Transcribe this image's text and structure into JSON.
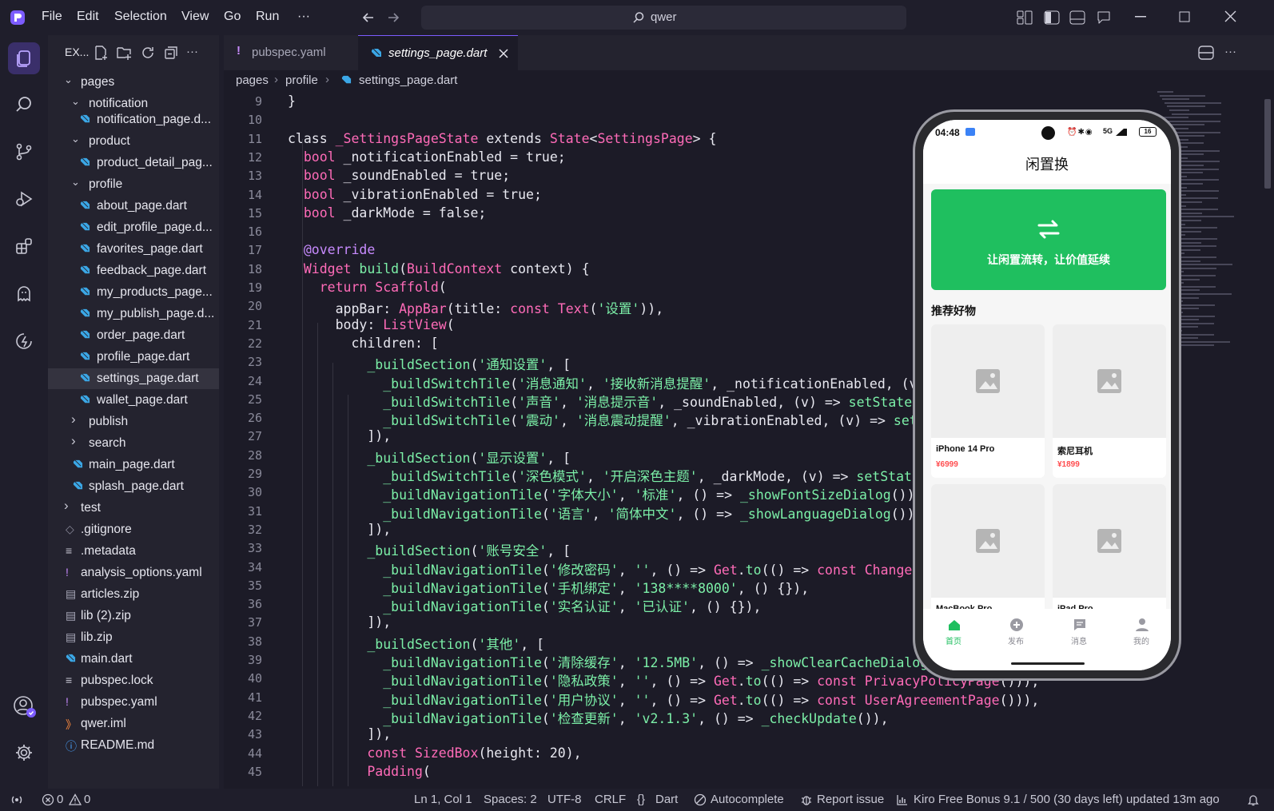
{
  "menu": [
    "File",
    "Edit",
    "Selection",
    "View",
    "Go",
    "Run",
    "···"
  ],
  "search": {
    "text": "qwer"
  },
  "explorer": {
    "title": "EX...",
    "items": [
      {
        "label": "pages",
        "kind": "folder-open",
        "indent": 1
      },
      {
        "label": "notification",
        "kind": "folder-open",
        "indent": 2
      },
      {
        "label": "notification_page.d...",
        "kind": "dart",
        "indent": 3
      },
      {
        "label": "product",
        "kind": "folder-open",
        "indent": 2
      },
      {
        "label": "product_detail_pag...",
        "kind": "dart",
        "indent": 3
      },
      {
        "label": "profile",
        "kind": "folder-open",
        "indent": 2
      },
      {
        "label": "about_page.dart",
        "kind": "dart",
        "indent": 3
      },
      {
        "label": "edit_profile_page.d...",
        "kind": "dart",
        "indent": 3
      },
      {
        "label": "favorites_page.dart",
        "kind": "dart",
        "indent": 3
      },
      {
        "label": "feedback_page.dart",
        "kind": "dart",
        "indent": 3
      },
      {
        "label": "my_products_page...",
        "kind": "dart",
        "indent": 3
      },
      {
        "label": "my_publish_page.d...",
        "kind": "dart",
        "indent": 3
      },
      {
        "label": "order_page.dart",
        "kind": "dart",
        "indent": 3
      },
      {
        "label": "profile_page.dart",
        "kind": "dart",
        "indent": 3
      },
      {
        "label": "settings_page.dart",
        "kind": "dart",
        "indent": 3,
        "selected": true
      },
      {
        "label": "wallet_page.dart",
        "kind": "dart",
        "indent": 3
      },
      {
        "label": "publish",
        "kind": "folder-closed",
        "indent": 2
      },
      {
        "label": "search",
        "kind": "folder-closed",
        "indent": 2
      },
      {
        "label": "main_page.dart",
        "kind": "dart",
        "indent": 2
      },
      {
        "label": "splash_page.dart",
        "kind": "dart",
        "indent": 2
      },
      {
        "label": "test",
        "kind": "folder-closed",
        "indent": 1
      },
      {
        "label": ".gitignore",
        "kind": "git",
        "indent": 1
      },
      {
        "label": ".metadata",
        "kind": "lines",
        "indent": 1
      },
      {
        "label": "analysis_options.yaml",
        "kind": "yaml",
        "indent": 1
      },
      {
        "label": "articles.zip",
        "kind": "zip",
        "indent": 1
      },
      {
        "label": "lib (2).zip",
        "kind": "zip",
        "indent": 1
      },
      {
        "label": "lib.zip",
        "kind": "zip",
        "indent": 1
      },
      {
        "label": "main.dart",
        "kind": "dart",
        "indent": 1
      },
      {
        "label": "pubspec.lock",
        "kind": "lines",
        "indent": 1
      },
      {
        "label": "pubspec.yaml",
        "kind": "yaml",
        "indent": 1
      },
      {
        "label": "qwer.iml",
        "kind": "rss",
        "indent": 1
      },
      {
        "label": "README.md",
        "kind": "info",
        "indent": 1
      }
    ]
  },
  "tabs": [
    {
      "label": "pubspec.yaml",
      "active": false
    },
    {
      "label": "settings_page.dart",
      "active": true
    }
  ],
  "breadcrumb": [
    "pages",
    "profile",
    "settings_page.dart"
  ],
  "code": [
    {
      "n": "9",
      "segs": [
        [
          "pl",
          "}"
        ]
      ]
    },
    {
      "n": "10",
      "segs": []
    },
    {
      "n": "11",
      "segs": [
        [
          "pl",
          "class "
        ],
        [
          "ty",
          "_SettingsPageState"
        ],
        [
          "pl",
          " extends "
        ],
        [
          "ty",
          "State"
        ],
        [
          "pl",
          "<"
        ],
        [
          "ty",
          "SettingsPage"
        ],
        [
          "pl",
          "> {"
        ]
      ]
    },
    {
      "n": "12",
      "segs": [
        [
          "pl",
          "  "
        ],
        [
          "kw",
          "bool"
        ],
        [
          "pl",
          " _notificationEnabled = true;"
        ]
      ]
    },
    {
      "n": "13",
      "segs": [
        [
          "pl",
          "  "
        ],
        [
          "kw",
          "bool"
        ],
        [
          "pl",
          " _soundEnabled = true;"
        ]
      ]
    },
    {
      "n": "14",
      "segs": [
        [
          "pl",
          "  "
        ],
        [
          "kw",
          "bool"
        ],
        [
          "pl",
          " _vibrationEnabled = true;"
        ]
      ]
    },
    {
      "n": "15",
      "segs": [
        [
          "pl",
          "  "
        ],
        [
          "kw",
          "bool"
        ],
        [
          "pl",
          " _darkMode = false;"
        ]
      ]
    },
    {
      "n": "16",
      "segs": []
    },
    {
      "n": "17",
      "segs": [
        [
          "pl",
          "  "
        ],
        [
          "an",
          "@override"
        ]
      ]
    },
    {
      "n": "18",
      "segs": [
        [
          "pl",
          "  "
        ],
        [
          "ty",
          "Widget"
        ],
        [
          "pl",
          " "
        ],
        [
          "fn",
          "build"
        ],
        [
          "pl",
          "("
        ],
        [
          "ty",
          "BuildContext"
        ],
        [
          "pl",
          " context) {"
        ]
      ]
    },
    {
      "n": "19",
      "segs": [
        [
          "pl",
          "    "
        ],
        [
          "kw",
          "return"
        ],
        [
          "pl",
          " "
        ],
        [
          "ty",
          "Scaffold"
        ],
        [
          "pl",
          "("
        ]
      ]
    },
    {
      "n": "20",
      "segs": [
        [
          "pl",
          "      appBar: "
        ],
        [
          "ty",
          "AppBar"
        ],
        [
          "pl",
          "(title: "
        ],
        [
          "kw",
          "const"
        ],
        [
          "pl",
          " "
        ],
        [
          "ty",
          "Text"
        ],
        [
          "pl",
          "("
        ],
        [
          "st",
          "'设置'"
        ],
        [
          "pl",
          ")),"
        ]
      ]
    },
    {
      "n": "21",
      "segs": [
        [
          "pl",
          "      body: "
        ],
        [
          "ty",
          "ListView"
        ],
        [
          "pl",
          "("
        ]
      ]
    },
    {
      "n": "22",
      "segs": [
        [
          "pl",
          "        children: ["
        ]
      ]
    },
    {
      "n": "23",
      "segs": [
        [
          "pl",
          "          "
        ],
        [
          "fn",
          "_buildSection"
        ],
        [
          "pl",
          "("
        ],
        [
          "st",
          "'通知设置'"
        ],
        [
          "pl",
          ", ["
        ]
      ]
    },
    {
      "n": "24",
      "segs": [
        [
          "pl",
          "            "
        ],
        [
          "fn",
          "_buildSwitchTile"
        ],
        [
          "pl",
          "("
        ],
        [
          "st",
          "'消息通知'"
        ],
        [
          "pl",
          ", "
        ],
        [
          "st",
          "'接收新消息提醒'"
        ],
        [
          "pl",
          ", _notificationEnabled, (v)"
        ]
      ]
    },
    {
      "n": "25",
      "segs": [
        [
          "pl",
          "            "
        ],
        [
          "fn",
          "_buildSwitchTile"
        ],
        [
          "pl",
          "("
        ],
        [
          "st",
          "'声音'"
        ],
        [
          "pl",
          ", "
        ],
        [
          "st",
          "'消息提示音'"
        ],
        [
          "pl",
          ", _soundEnabled, (v) => "
        ],
        [
          "fn",
          "setState"
        ],
        [
          "pl",
          "(()"
        ]
      ]
    },
    {
      "n": "26",
      "segs": [
        [
          "pl",
          "            "
        ],
        [
          "fn",
          "_buildSwitchTile"
        ],
        [
          "pl",
          "("
        ],
        [
          "st",
          "'震动'"
        ],
        [
          "pl",
          ", "
        ],
        [
          "st",
          "'消息震动提醒'"
        ],
        [
          "pl",
          ", _vibrationEnabled, (v) => "
        ],
        [
          "fn",
          "setSt"
        ]
      ]
    },
    {
      "n": "27",
      "segs": [
        [
          "pl",
          "          ]),"
        ]
      ]
    },
    {
      "n": "28",
      "segs": [
        [
          "pl",
          "          "
        ],
        [
          "fn",
          "_buildSection"
        ],
        [
          "pl",
          "("
        ],
        [
          "st",
          "'显示设置'"
        ],
        [
          "pl",
          ", ["
        ]
      ]
    },
    {
      "n": "29",
      "segs": [
        [
          "pl",
          "            "
        ],
        [
          "fn",
          "_buildSwitchTile"
        ],
        [
          "pl",
          "("
        ],
        [
          "st",
          "'深色模式'"
        ],
        [
          "pl",
          ", "
        ],
        [
          "st",
          "'开启深色主题'"
        ],
        [
          "pl",
          ", _darkMode, (v) => "
        ],
        [
          "fn",
          "setState"
        ],
        [
          "pl",
          "("
        ]
      ]
    },
    {
      "n": "30",
      "segs": [
        [
          "pl",
          "            "
        ],
        [
          "fn",
          "_buildNavigationTile"
        ],
        [
          "pl",
          "("
        ],
        [
          "st",
          "'字体大小'"
        ],
        [
          "pl",
          ", "
        ],
        [
          "st",
          "'标准'"
        ],
        [
          "pl",
          ", () => "
        ],
        [
          "fn",
          "_showFontSizeDialog"
        ],
        [
          "pl",
          "()),"
        ]
      ]
    },
    {
      "n": "31",
      "segs": [
        [
          "pl",
          "            "
        ],
        [
          "fn",
          "_buildNavigationTile"
        ],
        [
          "pl",
          "("
        ],
        [
          "st",
          "'语言'"
        ],
        [
          "pl",
          ", "
        ],
        [
          "st",
          "'简体中文'"
        ],
        [
          "pl",
          ", () => "
        ],
        [
          "fn",
          "_showLanguageDialog"
        ],
        [
          "pl",
          "()),"
        ]
      ]
    },
    {
      "n": "32",
      "segs": [
        [
          "pl",
          "          ]),"
        ]
      ]
    },
    {
      "n": "33",
      "segs": [
        [
          "pl",
          "          "
        ],
        [
          "fn",
          "_buildSection"
        ],
        [
          "pl",
          "("
        ],
        [
          "st",
          "'账号安全'"
        ],
        [
          "pl",
          ", ["
        ]
      ]
    },
    {
      "n": "34",
      "segs": [
        [
          "pl",
          "            "
        ],
        [
          "fn",
          "_buildNavigationTile"
        ],
        [
          "pl",
          "("
        ],
        [
          "st",
          "'修改密码'"
        ],
        [
          "pl",
          ", "
        ],
        [
          "st",
          "''"
        ],
        [
          "pl",
          ", () => "
        ],
        [
          "ty",
          "Get"
        ],
        [
          "pl",
          "."
        ],
        [
          "fn",
          "to"
        ],
        [
          "pl",
          "(() => "
        ],
        [
          "kw",
          "const"
        ],
        [
          "pl",
          " "
        ],
        [
          "ty",
          "ChangePas"
        ]
      ]
    },
    {
      "n": "35",
      "segs": [
        [
          "pl",
          "            "
        ],
        [
          "fn",
          "_buildNavigationTile"
        ],
        [
          "pl",
          "("
        ],
        [
          "st",
          "'手机绑定'"
        ],
        [
          "pl",
          ", "
        ],
        [
          "st",
          "'138****8000'"
        ],
        [
          "pl",
          ", () {}),"
        ]
      ]
    },
    {
      "n": "36",
      "segs": [
        [
          "pl",
          "            "
        ],
        [
          "fn",
          "_buildNavigationTile"
        ],
        [
          "pl",
          "("
        ],
        [
          "st",
          "'实名认证'"
        ],
        [
          "pl",
          ", "
        ],
        [
          "st",
          "'已认证'"
        ],
        [
          "pl",
          ", () {}),"
        ]
      ]
    },
    {
      "n": "37",
      "segs": [
        [
          "pl",
          "          ]),"
        ]
      ]
    },
    {
      "n": "38",
      "segs": [
        [
          "pl",
          "          "
        ],
        [
          "fn",
          "_buildSection"
        ],
        [
          "pl",
          "("
        ],
        [
          "st",
          "'其他'"
        ],
        [
          "pl",
          ", ["
        ]
      ]
    },
    {
      "n": "39",
      "segs": [
        [
          "pl",
          "            "
        ],
        [
          "fn",
          "_buildNavigationTile"
        ],
        [
          "pl",
          "("
        ],
        [
          "st",
          "'清除缓存'"
        ],
        [
          "pl",
          ", "
        ],
        [
          "st",
          "'12.5MB'"
        ],
        [
          "pl",
          ", () => "
        ],
        [
          "fn",
          "_showClearCacheDialog"
        ],
        [
          "pl",
          "("
        ]
      ]
    },
    {
      "n": "40",
      "segs": [
        [
          "pl",
          "            "
        ],
        [
          "fn",
          "_buildNavigationTile"
        ],
        [
          "pl",
          "("
        ],
        [
          "st",
          "'隐私政策'"
        ],
        [
          "pl",
          ", "
        ],
        [
          "st",
          "''"
        ],
        [
          "pl",
          ", () => "
        ],
        [
          "ty",
          "Get"
        ],
        [
          "pl",
          "."
        ],
        [
          "fn",
          "to"
        ],
        [
          "pl",
          "(() => "
        ],
        [
          "kw",
          "const"
        ],
        [
          "pl",
          " "
        ],
        [
          "ty",
          "PrivacyPolicyPage"
        ],
        [
          "pl",
          "())),"
        ]
      ]
    },
    {
      "n": "41",
      "segs": [
        [
          "pl",
          "            "
        ],
        [
          "fn",
          "_buildNavigationTile"
        ],
        [
          "pl",
          "("
        ],
        [
          "st",
          "'用户协议'"
        ],
        [
          "pl",
          ", "
        ],
        [
          "st",
          "''"
        ],
        [
          "pl",
          ", () => "
        ],
        [
          "ty",
          "Get"
        ],
        [
          "pl",
          "."
        ],
        [
          "fn",
          "to"
        ],
        [
          "pl",
          "(() => "
        ],
        [
          "kw",
          "const"
        ],
        [
          "pl",
          " "
        ],
        [
          "ty",
          "UserAgreementPage"
        ],
        [
          "pl",
          "())),"
        ]
      ]
    },
    {
      "n": "42",
      "segs": [
        [
          "pl",
          "            "
        ],
        [
          "fn",
          "_buildNavigationTile"
        ],
        [
          "pl",
          "("
        ],
        [
          "st",
          "'检查更新'"
        ],
        [
          "pl",
          ", "
        ],
        [
          "st",
          "'v2.1.3'"
        ],
        [
          "pl",
          ", () => "
        ],
        [
          "fn",
          "_checkUpdate"
        ],
        [
          "pl",
          "()),"
        ]
      ]
    },
    {
      "n": "43",
      "segs": [
        [
          "pl",
          "          ]),"
        ]
      ]
    },
    {
      "n": "44",
      "segs": [
        [
          "pl",
          "          "
        ],
        [
          "kw",
          "const"
        ],
        [
          "pl",
          " "
        ],
        [
          "ty",
          "SizedBox"
        ],
        [
          "pl",
          "(height: 20),"
        ]
      ]
    },
    {
      "n": "45",
      "segs": [
        [
          "pl",
          "          "
        ],
        [
          "ty",
          "Padding"
        ],
        [
          "pl",
          "("
        ]
      ]
    }
  ],
  "phone": {
    "time": "04:48",
    "battery": "16",
    "signal": "5G",
    "app_title": "闲置换",
    "banner_text": "让闲置流转，让价值延续",
    "section_title": "推荐好物",
    "products": [
      {
        "name": "iPhone 14 Pro",
        "price": "¥6999"
      },
      {
        "name": "索尼耳机",
        "price": "¥1899"
      },
      {
        "name": "MacBook Pro",
        "price": ""
      },
      {
        "name": "iPad Pro",
        "price": ""
      }
    ],
    "nav": [
      {
        "label": "首页",
        "active": true
      },
      {
        "label": "发布",
        "active": false
      },
      {
        "label": "消息",
        "active": false
      },
      {
        "label": "我的",
        "active": false
      }
    ]
  },
  "status": {
    "errors": "0",
    "warnings": "0",
    "position": "Ln 1, Col 1",
    "spaces": "Spaces: 2",
    "encoding": "UTF-8",
    "eol": "CRLF",
    "language": "Dart",
    "autocomplete": "Autocomplete",
    "report": "Report issue",
    "bonus": "Kiro Free Bonus 9.1 / 500 (30 days left) updated 13m ago"
  },
  "colors": {
    "accent": "#7c5cff",
    "green": "#1fbf5f",
    "price": "#ff4d4f"
  }
}
